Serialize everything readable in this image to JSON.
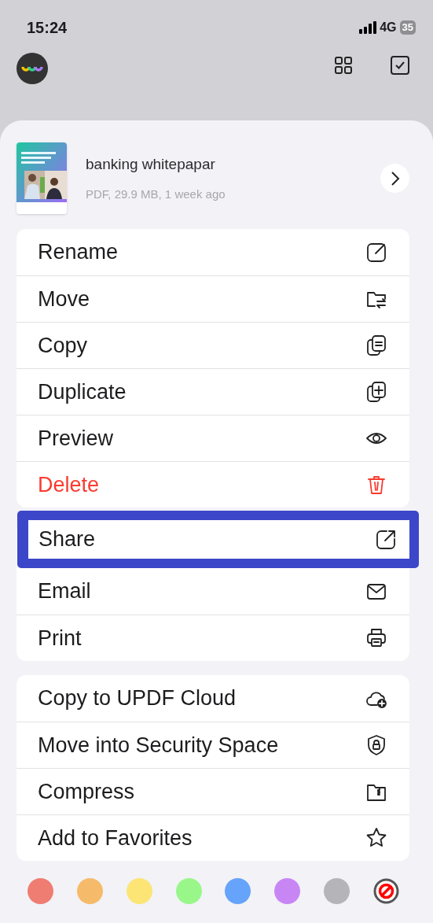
{
  "status_bar": {
    "time": "15:24",
    "network": "4G",
    "battery": "35"
  },
  "file": {
    "name": "banking whitepapar",
    "details": "PDF, 29.9 MB, 1 week ago"
  },
  "action_groups": [
    {
      "items": [
        {
          "label": "Rename",
          "destructive": false,
          "highlighted": false
        },
        {
          "label": "Move",
          "destructive": false,
          "highlighted": false
        },
        {
          "label": "Copy",
          "destructive": false,
          "highlighted": false
        },
        {
          "label": "Duplicate",
          "destructive": false,
          "highlighted": false
        },
        {
          "label": "Preview",
          "destructive": false,
          "highlighted": false
        },
        {
          "label": "Delete",
          "destructive": true,
          "highlighted": false
        }
      ]
    },
    {
      "items": [
        {
          "label": "Share",
          "destructive": false,
          "highlighted": true
        },
        {
          "label": "Email",
          "destructive": false,
          "highlighted": false
        },
        {
          "label": "Print",
          "destructive": false,
          "highlighted": false
        }
      ]
    },
    {
      "items": [
        {
          "label": "Copy to UPDF Cloud",
          "destructive": false,
          "highlighted": false
        },
        {
          "label": "Move into Security Space",
          "destructive": false,
          "highlighted": false
        },
        {
          "label": "Compress",
          "destructive": false,
          "highlighted": false
        },
        {
          "label": "Add to Favorites",
          "destructive": false,
          "highlighted": false
        }
      ]
    }
  ],
  "color_tags": [
    {
      "kind": "color",
      "color": "#ef7d72"
    },
    {
      "kind": "color",
      "color": "#f5bb6a"
    },
    {
      "kind": "color",
      "color": "#fce575"
    },
    {
      "kind": "color",
      "color": "#99f78a"
    },
    {
      "kind": "color",
      "color": "#66a3fa"
    },
    {
      "kind": "color",
      "color": "#c886f5"
    },
    {
      "kind": "color",
      "color": "#b4b4b9"
    },
    {
      "kind": "none"
    }
  ]
}
